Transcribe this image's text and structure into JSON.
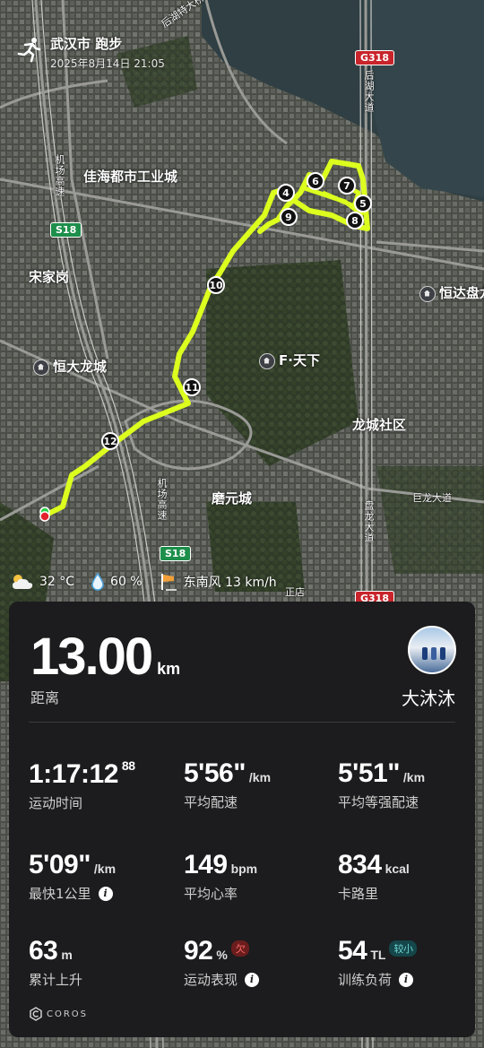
{
  "header": {
    "title": "武汉市 跑步",
    "datetime": "2025年8月14日 21:05",
    "icon": "running-person-icon"
  },
  "map": {
    "labels": {
      "industrial_city": "佳海都市工业城",
      "songjiagang": "宋家岗",
      "hengda_longcheng": "恒大龙城",
      "hengda_panlong": "恒达盘龙",
      "f_tianxia": "F·天下",
      "longcheng_community": "龙城社区",
      "moyuancheng": "磨元城",
      "julong_avenue": "巨龙大道",
      "airport_expressway": "机场高速",
      "airport_expressway_2": "机场高速",
      "houhu_avenue": "后湖大道",
      "panlong_avenue": "盘龙大道",
      "houhu_avenue_top": "后湖特大桥",
      "zhengdian": "正店"
    },
    "road_shields": {
      "g318_top": "G318",
      "s18_left": "S18",
      "s18_bottom": "S18",
      "g318_bottom": "G318"
    },
    "km_markers": [
      "4",
      "5",
      "6",
      "7",
      "8",
      "9",
      "10",
      "11",
      "12"
    ],
    "route_color": "#dcff1e"
  },
  "weather": {
    "temperature": "32 °C",
    "humidity": "60 %",
    "wind": "东南风 13 km/h"
  },
  "summary": {
    "distance_value": "13.00",
    "distance_unit": "km",
    "distance_label": "距离",
    "username": "大沐沐"
  },
  "stats": {
    "time": {
      "value": "1:17:12",
      "sup": "88",
      "label": "运动时间"
    },
    "avg_pace": {
      "value": "5'56\"",
      "unit": "/km",
      "label": "平均配速"
    },
    "grade_pace": {
      "value": "5'51\"",
      "unit": "/km",
      "label": "平均等强配速"
    },
    "fastest_km": {
      "value": "5'09\"",
      "unit": "/km",
      "label": "最快1公里"
    },
    "avg_hr": {
      "value": "149",
      "unit": "bpm",
      "label": "平均心率"
    },
    "calories": {
      "value": "834",
      "unit": "kcal",
      "label": "卡路里"
    },
    "elevation": {
      "value": "63",
      "unit": "m",
      "label": "累计上升"
    },
    "performance": {
      "value": "92",
      "unit": "%",
      "badge": "欠",
      "label": "运动表现"
    },
    "training_load": {
      "value": "54",
      "unit": "TL",
      "badge": "较小",
      "label": "训练负荷"
    }
  },
  "brand": "COROS"
}
